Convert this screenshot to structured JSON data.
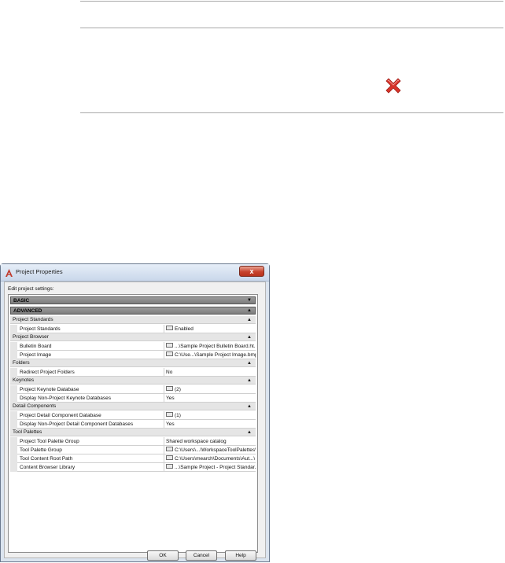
{
  "dialog": {
    "title": "Project Properties",
    "close_glyph": "x",
    "edit_label": "Edit project settings:",
    "sections": {
      "basic": {
        "label": "BASIC",
        "arrow": "▼"
      },
      "advanced": {
        "label": "ADVANCED",
        "arrow": "▲"
      }
    },
    "categories": [
      {
        "label": "Project Standards",
        "arrow": "▲",
        "rows": [
          {
            "name": "Project Standards",
            "value": "Enabled",
            "browse": true
          }
        ]
      },
      {
        "label": "Project Browser",
        "arrow": "▲",
        "rows": [
          {
            "name": "Bulletin Board",
            "value": "...\\Sample Project Bulletin Board.ht...",
            "browse": true
          },
          {
            "name": "Project Image",
            "value": "C:\\Use...\\Sample Project Image.bmp",
            "browse": true
          }
        ]
      },
      {
        "label": "Folders",
        "arrow": "▲",
        "rows": [
          {
            "name": "Redirect Project Folders",
            "value": "No",
            "browse": false
          }
        ]
      },
      {
        "label": "Keynotes",
        "arrow": "▲",
        "rows": [
          {
            "name": "Project Keynote Database",
            "value": "(2)",
            "browse": true
          },
          {
            "name": "Display Non-Project Keynote Databases",
            "value": "Yes",
            "browse": false
          }
        ]
      },
      {
        "label": "Detail Components",
        "arrow": "▲",
        "rows": [
          {
            "name": "Project Detail Component Database",
            "value": "(1)",
            "browse": true
          },
          {
            "name": "Display Non-Project Detail Component Databases",
            "value": "Yes",
            "browse": false
          }
        ]
      },
      {
        "label": "Tool Palettes",
        "arrow": "▲",
        "rows": [
          {
            "name": "Project Tool Palette Group",
            "value": "Shared workspace catalog",
            "browse": false
          },
          {
            "name": "Tool Palette Group",
            "value": "C:\\Users\\...\\WorkspaceToolPalettes\\",
            "browse": true
          },
          {
            "name": "Tool Content Root Path",
            "value": "C:\\Users\\mearch\\Documents\\Aut...\\",
            "browse": true
          },
          {
            "name": "Content Browser Library",
            "value": "...\\Sample Project - Project Standar...",
            "browse": true
          }
        ]
      }
    ],
    "buttons": {
      "ok": "OK",
      "cancel": "Cancel",
      "help": "Help"
    }
  },
  "icons": {
    "close_x": "red-x-icon",
    "app": "autocad-app-icon"
  },
  "colors": {
    "close_x": "#d9342b",
    "close_button": "#c7432d",
    "section_band": "#8d8d8d"
  }
}
